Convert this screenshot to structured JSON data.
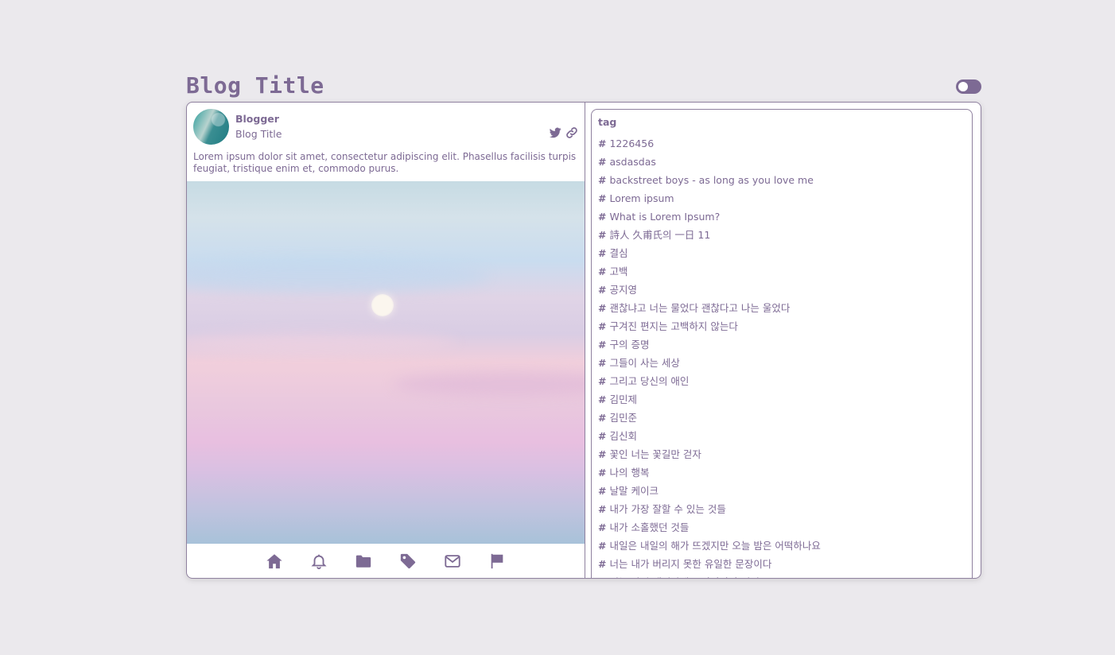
{
  "header": {
    "title": "Blog Title",
    "theme_toggle": "off"
  },
  "profile": {
    "name": "Blogger",
    "blog_title": "Blog Title",
    "social_icons": [
      "twitter-icon",
      "link-icon"
    ],
    "description": "Lorem ipsum dolor sit amet, consectetur adipiscing elit. Phasellus facilisis turpis feugiat, tristique enim et, commodo purus."
  },
  "nav": {
    "icons": [
      "home-icon",
      "bell-icon",
      "folder-icon",
      "tag-icon",
      "mail-icon",
      "flag-icon"
    ]
  },
  "tags": {
    "heading": "tag",
    "hash": "#",
    "items": [
      "1226456",
      "asdasdas",
      "backstreet boys - as long as you love me",
      "Lorem ipsum",
      "What is Lorem Ipsum?",
      "詩人 久甫氏의 一日 11",
      "결심",
      "고백",
      "공지영",
      "괜찮냐고 너는 물었다 괜찮다고 나는 울었다",
      "구겨진 편지는 고백하지 않는다",
      "구의 증명",
      "그들이 사는 세상",
      "그리고 당신의 애인",
      "김민제",
      "김민준",
      "김신회",
      "꽃인 너는 꽃길만 걷자",
      "나의 행복",
      "날말 케이크",
      "내가 가장 잘할 수 있는 것들",
      "내가 소홀했던 것들",
      "내일은 내일의 해가 뜨겠지만 오늘 밤은 어떡하나요",
      "너는 내가 버리지 못한 유일한 문장이다",
      "너는 다시 태어나겠고 가닥가닥 있어"
    ]
  },
  "colors": {
    "accent": "#7d6a94",
    "background": "#ebe9ed",
    "border": "#8f819f"
  }
}
